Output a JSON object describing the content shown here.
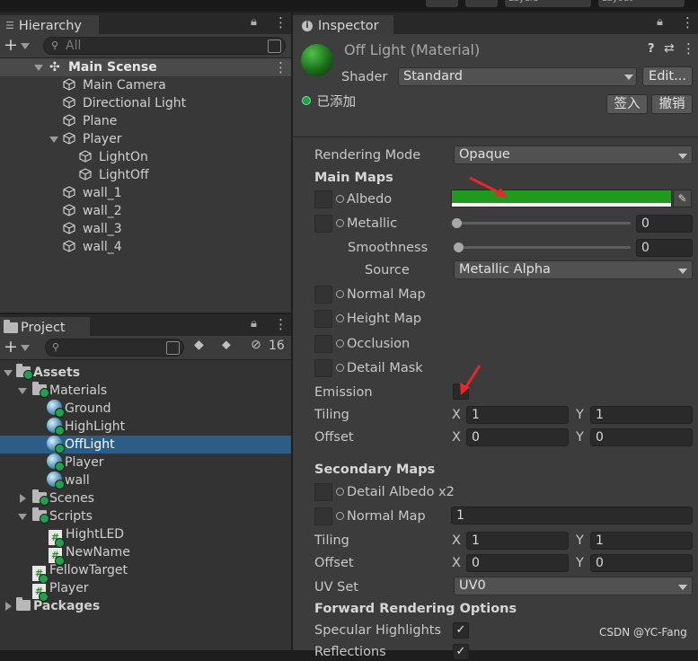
{
  "top": {
    "layers_label": "Layers",
    "layout_label": "Layout"
  },
  "hierarchy": {
    "tab": "Hierarchy",
    "search_placeholder": "All",
    "scene": "Main Scense",
    "items": [
      "Main Camera",
      "Directional Light",
      "Plane",
      "Player",
      "LightOn",
      "LightOff",
      "wall_1",
      "wall_2",
      "wall_3",
      "wall_4"
    ]
  },
  "project": {
    "tab": "Project",
    "hidden_count": "16",
    "items": [
      "Assets",
      "Materials",
      "Ground",
      "HighLight",
      "OffLight",
      "Player",
      "wall",
      "Scenes",
      "Scripts",
      "HightLED",
      "NewName",
      "FellowTarget",
      "Player",
      "Packages"
    ]
  },
  "inspector": {
    "tab": "Inspector",
    "title": "Off Light (Material)",
    "shader_label": "Shader",
    "shader_value": "Standard",
    "edit_button": "Edit...",
    "added_label": "已添加",
    "sign_in_button": "签入",
    "revoke_button": "撤销",
    "rendering_mode_label": "Rendering Mode",
    "rendering_mode_value": "Opaque",
    "main_maps": "Main Maps",
    "albedo": "Albedo",
    "albedo_color": "#1f9a1c",
    "metallic": "Metallic",
    "metallic_value": "0",
    "smoothness": "Smoothness",
    "smoothness_value": "0",
    "source": "Source",
    "source_value": "Metallic Alpha",
    "normal_map": "Normal Map",
    "height_map": "Height Map",
    "occlusion": "Occlusion",
    "detail_mask": "Detail Mask",
    "emission": "Emission",
    "tiling": "Tiling",
    "offset": "Offset",
    "x": "X",
    "y": "Y",
    "tiling_x": "1",
    "tiling_y": "1",
    "offset_x": "0",
    "offset_y": "0",
    "secondary_maps": "Secondary Maps",
    "detail_albedo": "Detail Albedo x2",
    "normal_map2": "Normal Map",
    "normal_map2_value": "1",
    "tiling2_x": "1",
    "tiling2_y": "1",
    "offset2_x": "0",
    "offset2_y": "0",
    "uv_set": "UV Set",
    "uv_set_value": "UV0",
    "forward_options": "Forward Rendering Options",
    "specular_highlights": "Specular Highlights",
    "reflections": "Reflections"
  },
  "watermark": "CSDN @YC-Fang",
  "colors": {
    "selection": "#2c5d87",
    "accent_green": "#1fa34a",
    "arrow_red": "#e8262b"
  }
}
